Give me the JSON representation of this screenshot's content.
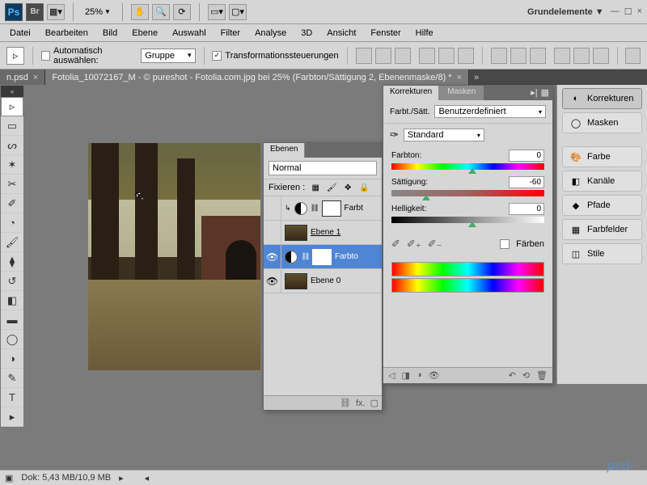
{
  "topbar": {
    "zoom": "25%",
    "workspace": "Grundelemente"
  },
  "menu": [
    "Datei",
    "Bearbeiten",
    "Bild",
    "Ebene",
    "Auswahl",
    "Filter",
    "Analyse",
    "3D",
    "Ansicht",
    "Fenster",
    "Hilfe"
  ],
  "optbar": {
    "auto_select": "Automatisch auswählen:",
    "group_dd": "Gruppe",
    "transform": "Transformationssteuerungen"
  },
  "tabs": [
    {
      "label": "n.psd",
      "close": "×"
    },
    {
      "label": "Fotolia_10072167_M - © pureshot - Fotolia.com.jpg bei 25% (Farbton/Sättigung 2, Ebenenmaske/8) *",
      "close": "×"
    }
  ],
  "layers": {
    "tab": "Ebenen",
    "blend": "Normal",
    "lock_label": "Fixieren :",
    "items": [
      {
        "name": "Farbt",
        "adj": true,
        "visible": false
      },
      {
        "name": "Ebene 1",
        "img": true,
        "visible": false
      },
      {
        "name": "Farbto",
        "adj": true,
        "visible": true,
        "selected": true
      },
      {
        "name": "Ebene 0",
        "img": true,
        "visible": true
      }
    ]
  },
  "adjust": {
    "tab1": "Korrekturen",
    "tab2": "Masken",
    "title": "Farbt./Sätt.",
    "preset": "Benutzerdefiniert",
    "range": "Standard",
    "hue_label": "Farbton:",
    "hue_val": "0",
    "sat_label": "Sättigung:",
    "sat_val": "-60",
    "light_label": "Helligkeit:",
    "light_val": "0",
    "colorize": "Färben"
  },
  "dock": {
    "korrekturen": "Korrekturen",
    "masken": "Masken",
    "farbe": "Farbe",
    "kanale": "Kanäle",
    "pfade": "Pfade",
    "farbfelder": "Farbfelder",
    "stile": "Stile"
  },
  "status": {
    "doc": "Dok: 5,43 MB/10,9 MB"
  },
  "watermark": "psd-"
}
